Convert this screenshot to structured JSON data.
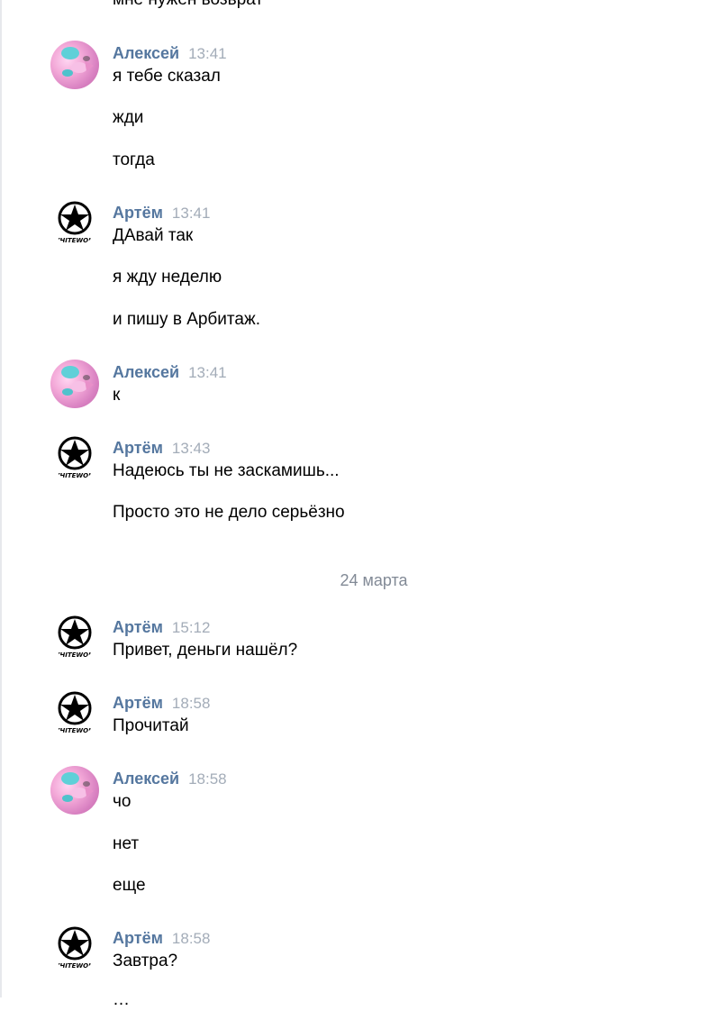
{
  "chat": {
    "top_partial_text": "мне нужен возврат",
    "date_divider": "24 марта",
    "bottom_partial_text": "…",
    "groups": [
      {
        "author": "Алексей",
        "time": "13:41",
        "messages": [
          "я тебе сказал",
          "жди",
          "тогда"
        ]
      },
      {
        "author": "Артём",
        "time": "13:41",
        "messages": [
          "ДАвай так",
          "я жду неделю",
          "и пишу в Арбитаж."
        ]
      },
      {
        "author": "Алексей",
        "time": "13:41",
        "messages": [
          "к"
        ]
      },
      {
        "author": "Артём",
        "time": "13:43",
        "messages": [
          "Надеюсь ты не заскамишь...",
          "Просто это не дело серьёзно"
        ]
      },
      {
        "author": "Артём",
        "time": "15:12",
        "messages": [
          "Привет, деньги нашёл?"
        ]
      },
      {
        "author": "Артём",
        "time": "18:58",
        "messages": [
          "Прочитай"
        ]
      },
      {
        "author": "Алексей",
        "time": "18:58",
        "messages": [
          "чо",
          "нет",
          "еще"
        ]
      },
      {
        "author": "Артём",
        "time": "18:58",
        "messages": [
          "Завтра?"
        ]
      }
    ]
  },
  "avatars": {
    "aleksey_icon": "pink-character-avatar",
    "artem_icon": "whitewolf-star-logo-avatar"
  },
  "colors": {
    "author_name": "#55779f",
    "timestamp": "#a3acb8",
    "message_text": "#000000",
    "date_divider": "#828a96"
  }
}
